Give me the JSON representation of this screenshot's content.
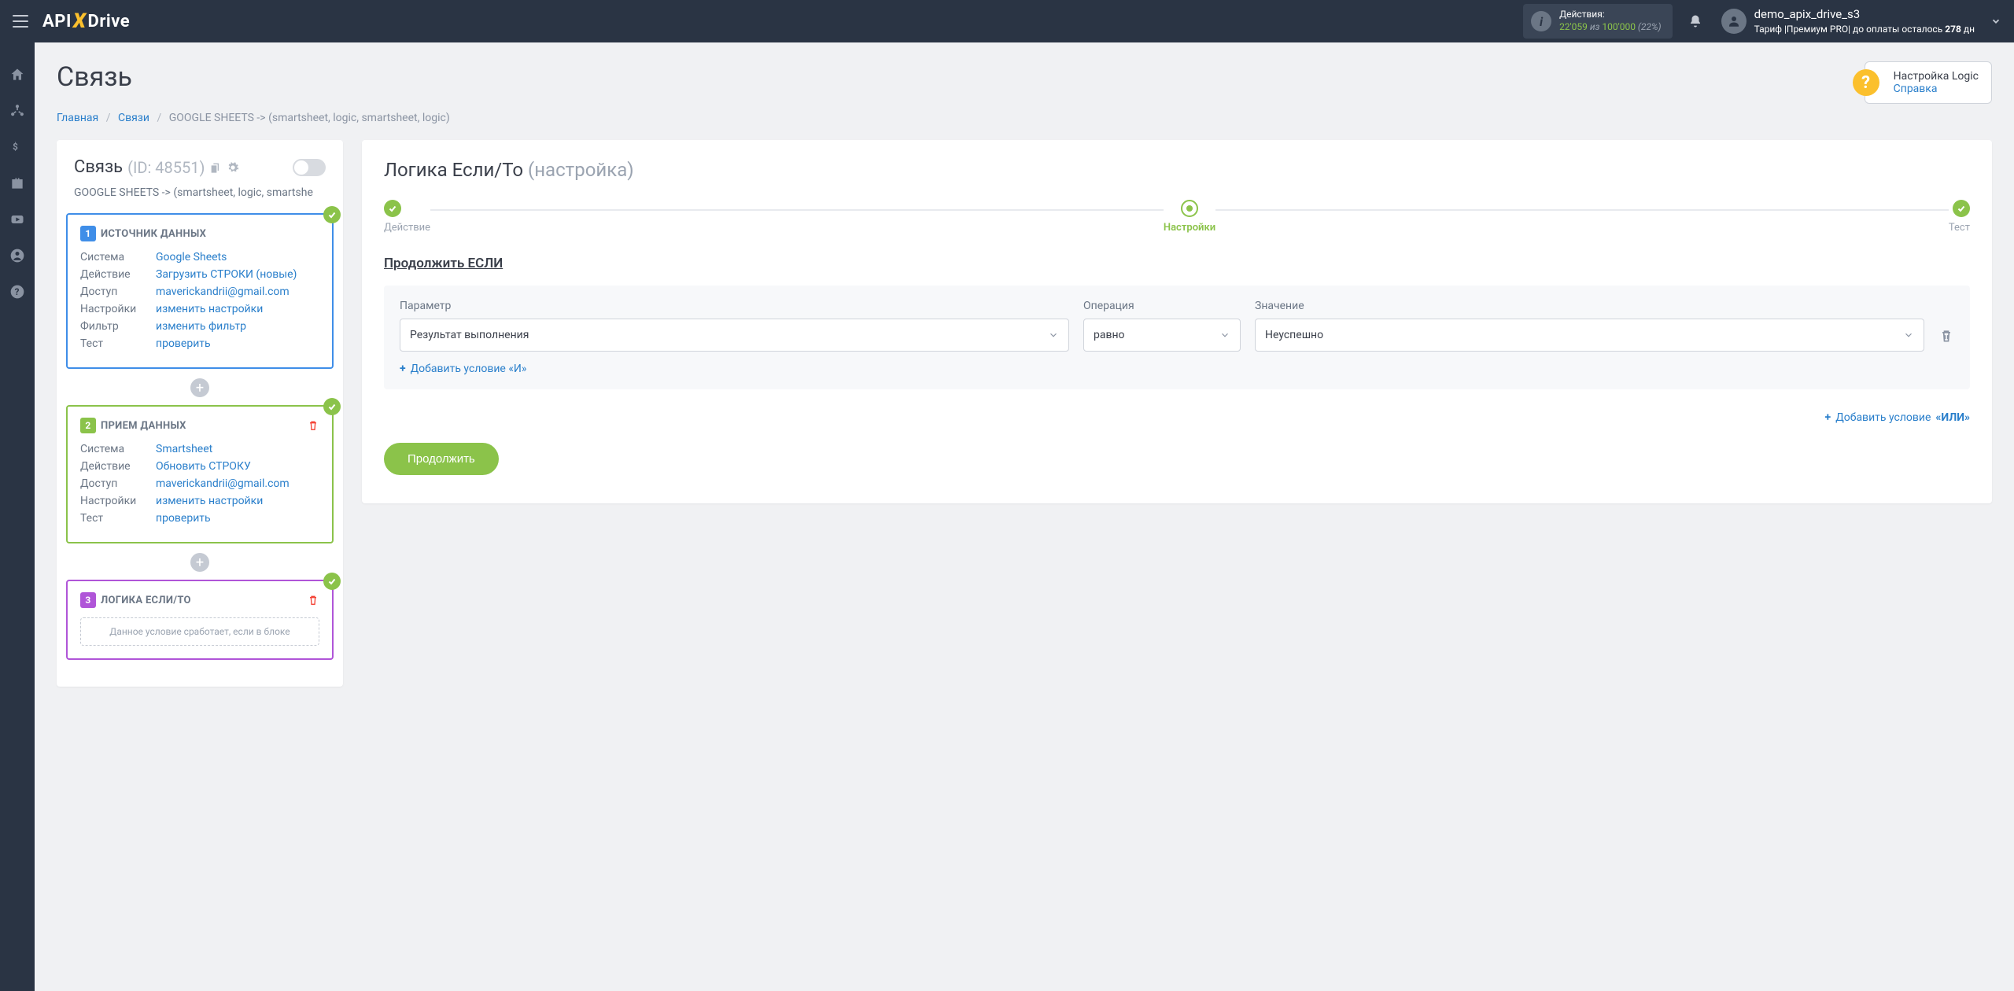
{
  "topbar": {
    "logo_pre": "API",
    "logo_x": "X",
    "logo_post": "Drive",
    "actions_label": "Действия:",
    "actions_used": "22'059",
    "actions_of": " из ",
    "actions_total": "100'000",
    "actions_pct": " (22%)",
    "username": "demo_apix_drive_s3",
    "tariff_pre": "Тариф |Премиум PRO| до оплаты осталось ",
    "tariff_days": "278",
    "tariff_post": " дн"
  },
  "help": {
    "line1": "Настройка Logic",
    "line2": "Справка"
  },
  "page": {
    "title": "Связь"
  },
  "breadcrumb": {
    "home": "Главная",
    "links": "Связи",
    "current": "GOOGLE SHEETS -> (smartsheet, logic, smartsheet, logic)"
  },
  "left": {
    "title": "Связь",
    "id": "(ID: 48551)",
    "sub": "GOOGLE SHEETS -> (smartsheet, logic, smartshe",
    "block1": {
      "num": "1",
      "title": "ИСТОЧНИК ДАННЫХ",
      "rows": [
        {
          "k": "Система",
          "v": "Google Sheets"
        },
        {
          "k": "Действие",
          "v": "Загрузить СТРОКИ (новые)"
        },
        {
          "k": "Доступ",
          "v": "maverickandrii@gmail.com"
        },
        {
          "k": "Настройки",
          "v": "изменить настройки"
        },
        {
          "k": "Фильтр",
          "v": "изменить фильтр"
        },
        {
          "k": "Тест",
          "v": "проверить"
        }
      ]
    },
    "block2": {
      "num": "2",
      "title": "ПРИЕМ ДАННЫХ",
      "rows": [
        {
          "k": "Система",
          "v": "Smartsheet"
        },
        {
          "k": "Действие",
          "v": "Обновить СТРОКУ"
        },
        {
          "k": "Доступ",
          "v": "maverickandrii@gmail.com"
        },
        {
          "k": "Настройки",
          "v": "изменить настройки"
        },
        {
          "k": "Тест",
          "v": "проверить"
        }
      ]
    },
    "block3": {
      "num": "3",
      "title": "ЛОГИКА ЕСЛИ/ТО",
      "note": "Данное условие сработает, если в блоке"
    }
  },
  "right": {
    "title_main": "Логика Если/То ",
    "title_sub": "(настройка)",
    "steps": {
      "s1": "Действие",
      "s2": "Настройки",
      "s3": "Тест"
    },
    "section": "Продолжить ЕСЛИ",
    "labels": {
      "param": "Параметр",
      "op": "Операция",
      "val": "Значение"
    },
    "values": {
      "param": "Результат выполнения",
      "op": "равно",
      "val": "Неуспешно"
    },
    "add_and": "Добавить условие «И»",
    "add_or_pre": "Добавить условие ",
    "add_or_bold": "«ИЛИ»",
    "continue": "Продолжить"
  }
}
